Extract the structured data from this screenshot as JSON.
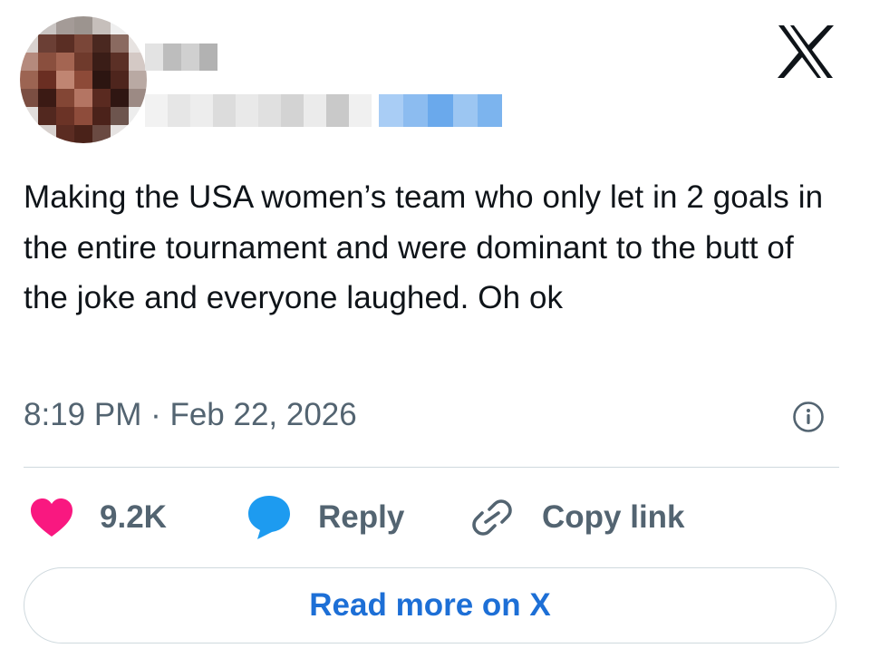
{
  "header": {
    "brand_icon": "x-logo-icon"
  },
  "tweet": {
    "text": "Making the USA women’s team who only let in 2 goals in the entire tournament and were dominant to the butt of the joke and everyone laughed. Oh ok",
    "timestamp": "8:19 PM · Feb 22, 2026"
  },
  "actions": {
    "like_count": "9.2K",
    "reply_label": "Reply",
    "copy_link_label": "Copy link",
    "read_more_label": "Read more on X"
  },
  "colors": {
    "like": "#f91880",
    "reply": "#1d9bf0",
    "muted_text": "#536471",
    "link": "#1d6fd6",
    "border": "#cfd9de"
  }
}
